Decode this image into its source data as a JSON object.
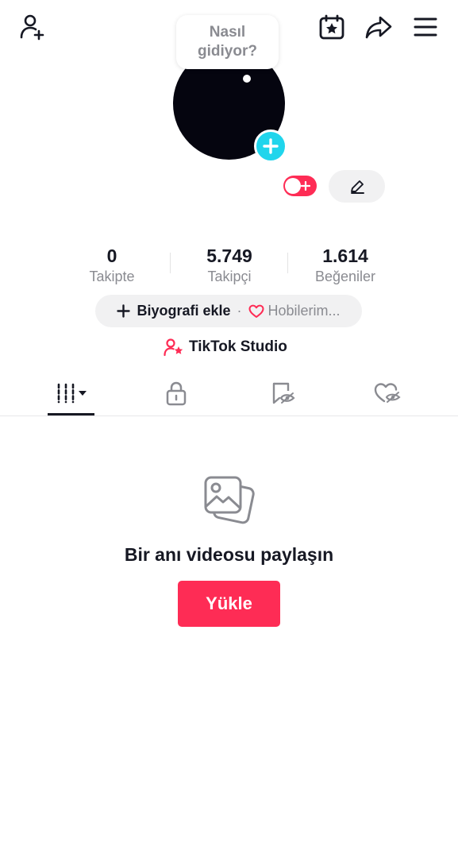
{
  "header": {
    "add_friend_icon": "person-plus-icon",
    "calendar_icon": "calendar-star-icon",
    "share_icon": "share-arrow-icon",
    "menu_icon": "hamburger-menu-icon"
  },
  "bubble": {
    "line1": "Nasıl",
    "line2": "gidiyor?"
  },
  "profile": {
    "avatar_add_icon": "plus-icon",
    "edit_icon": "pencil-icon"
  },
  "stats": [
    {
      "value": "0",
      "label": "Takipte"
    },
    {
      "value": "5.749",
      "label": "Takipçi"
    },
    {
      "value": "1.614",
      "label": "Beğeniler"
    }
  ],
  "bio": {
    "add_label": "Biyografi ekle",
    "separator": "·",
    "hobbies_label": "Hobilerim..."
  },
  "studio": {
    "label": "TikTok Studio"
  },
  "tabs": [
    {
      "name": "videos",
      "icon": "grid-bars-icon"
    },
    {
      "name": "private",
      "icon": "lock-icon"
    },
    {
      "name": "reposts",
      "icon": "repost-hidden-icon"
    },
    {
      "name": "liked",
      "icon": "heart-hidden-icon"
    }
  ],
  "empty_state": {
    "icon": "photos-icon",
    "title": "Bir anı videosu paylaşın",
    "button_label": "Yükle"
  },
  "colors": {
    "accent": "#fe2c55",
    "avatar_add": "#20d5ec",
    "text_primary": "#161823",
    "text_secondary": "#8a8b91"
  }
}
